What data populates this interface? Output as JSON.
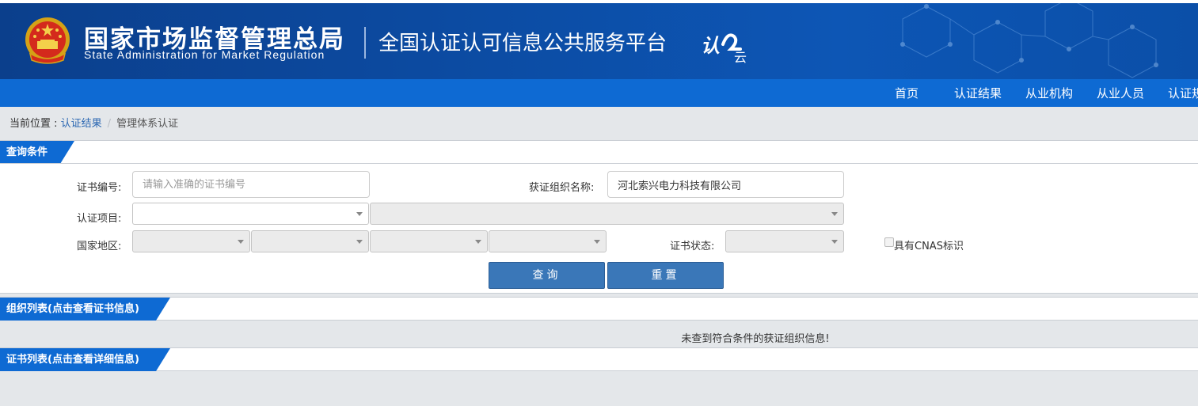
{
  "header": {
    "agency_cn": "国家市场监督管理总局",
    "agency_en": "State Administration  for  Market Regulation",
    "platform": "全国认证认可信息公共服务平台",
    "logo_text": "认云"
  },
  "nav": {
    "items": [
      {
        "label": "首页"
      },
      {
        "label": "认证结果"
      },
      {
        "label": "从业机构"
      },
      {
        "label": "从业人员"
      },
      {
        "label": "认证规"
      }
    ]
  },
  "breadcrumb": {
    "prefix": "当前位置 : ",
    "parent": "认证结果",
    "separator": "/",
    "current": "管理体系认证"
  },
  "query": {
    "title": "查询条件",
    "cert_no_label": "证书编号:",
    "cert_no_placeholder": "请输入准确的证书编号",
    "org_name_label": "获证组织名称:",
    "org_name_value": "河北索兴电力科技有限公司",
    "cert_item_label": "认证项目:",
    "region_label": "国家地区:",
    "cert_status_label": "证书状态:",
    "cnas_label": "具有CNAS标识",
    "search_button": "查询",
    "reset_button": "重置"
  },
  "org_list": {
    "title": "组织列表(点击查看证书信息)",
    "empty_message": "未查到符合条件的获证组织信息!"
  },
  "cert_list": {
    "title": "证书列表(点击查看详细信息)"
  },
  "colors": {
    "banner": "#0c4aa0",
    "nav": "#0e6ad3",
    "button": "#3a77b8",
    "link": "#2b67b2"
  }
}
